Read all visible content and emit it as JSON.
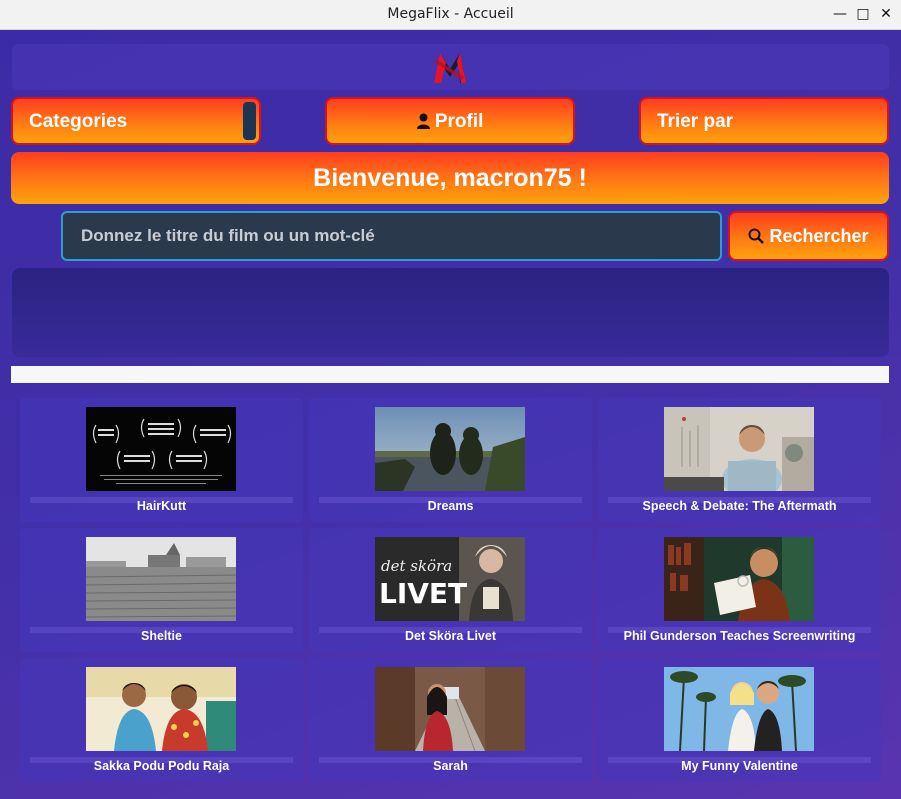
{
  "window": {
    "title": "MegaFlix - Accueil",
    "minimize": "—",
    "maximize": "□",
    "close": "✕"
  },
  "nav": {
    "categories_label": "Categories",
    "profil_label": "Profil",
    "trier_label": "Trier par"
  },
  "welcome": {
    "text": "Bienvenue, macron75 !"
  },
  "search": {
    "placeholder": "Donnez le titre du film ou un mot-clé",
    "button_label": "Rechercher"
  },
  "colors": {
    "accent_orange": "#ff7a14",
    "accent_red": "#d8121c",
    "background": "#3b2fa3",
    "input_bg": "#2a3a4c",
    "input_border": "#2b9fd1"
  },
  "movies": [
    {
      "title": "HairKutt",
      "thumb": "black-laurels"
    },
    {
      "title": "Dreams",
      "thumb": "lake-people"
    },
    {
      "title": "Speech & Debate: The Aftermath",
      "thumb": "man-office"
    },
    {
      "title": "Sheltie",
      "thumb": "field-bw"
    },
    {
      "title": "Det Sköra Livet",
      "thumb": "det-skora-livet",
      "thumb_text_top": "det sköra",
      "thumb_text_big": "LIVET"
    },
    {
      "title": "Phil Gunderson Teaches Screenwriting",
      "thumb": "man-paper"
    },
    {
      "title": "Sakka Podu Podu Raja",
      "thumb": "two-men"
    },
    {
      "title": "Sarah",
      "thumb": "woman-street"
    },
    {
      "title": "My Funny Valentine",
      "thumb": "couple-palms"
    }
  ]
}
